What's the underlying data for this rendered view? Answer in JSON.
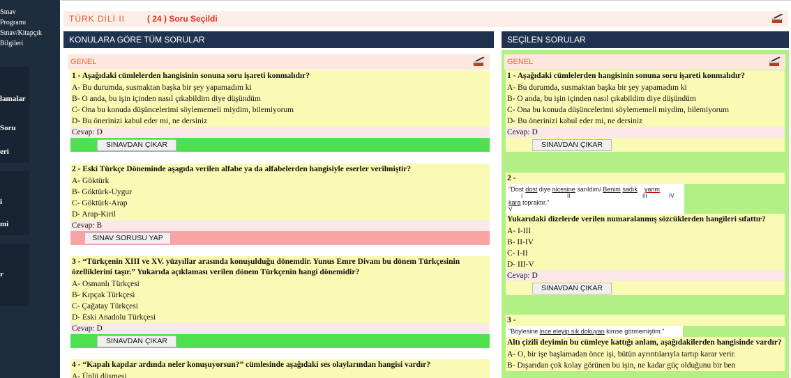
{
  "sidebar": {
    "top_links": [
      "Sınav",
      "Programı",
      "Sınav/Kitapçık",
      "Bilgileri"
    ],
    "blocks": [
      {
        "label": "lamalar"
      },
      {
        "label": "Soru"
      },
      {
        "label": "eri"
      },
      {
        "label": "i"
      },
      {
        "label": "mi"
      },
      {
        "label": "r"
      }
    ]
  },
  "header": {
    "title": "TÜRK DİLİ II",
    "selected": "( 24 ) Soru Seçildi"
  },
  "left": {
    "heading": "KONULARA GÖRE TÜM SORULAR",
    "section": "GENEL",
    "questions": [
      {
        "title": "1 - Aşağıdaki cümlelerden hangisinin sonuna soru işareti konmalıdır?",
        "options": [
          "A- Bu durumda, susmaktan başka bir şey yapamadım ki",
          "B- O anda, bu işin içinden nasıl çıkabildim diye düşündüm",
          "C- Ona bu konuda düşüncelerimi söylememeli miydim, bilemiyorum",
          "D- Bu önerinizi kabul eder mi, ne dersiniz"
        ],
        "answer": "Cevap: D",
        "button": "SINAVDAN ÇIKAR"
      },
      {
        "title": "2 - Eski Türkçe Döneminde aşagıda verilen alfabe ya da alfabelerden hangisiyle eserler verilmiştir?",
        "options": [
          "A- Göktürk",
          "B- Göktürk-Uygur",
          "C- Göktürk-Arap",
          "D- Arap-Kiril"
        ],
        "answer": "Cevap: B",
        "button": "SINAV SORUSU YAP"
      },
      {
        "title": "3 - “Türkçenin XIII ve XV. yüzyıllar arasında konuşulduğu dönemdir. Yunus Emre Divanı bu dönem Türkçesinin özelliklerini taşır.” Yukarıda açıklaması verilen dönem Türkçenin hangi dönemidir?",
        "options": [
          "A- Osmanlı Türkçesi",
          "B- Kıpçak Türkçesi",
          "C- Çağatay Türkçesi",
          "D- Eski Anadolu Türkçesi"
        ],
        "answer": "Cevap: D",
        "button": "SINAVDAN ÇIKAR"
      },
      {
        "title": "4 - “Kapalı kapılar ardında neler konuşuyorsun?” cümlesinde aşağıdaki ses olaylarından hangisi vardır?",
        "options": [
          "A- Ünlü düşmesi"
        ]
      }
    ]
  },
  "right": {
    "heading": "SEÇİLEN SORULAR",
    "section": "GENEL",
    "q1": {
      "title": "1 - Aşağıdaki cümlelerden hangisinin sonuna soru işareti konmalıdır?",
      "options": [
        "A- Bu durumda, susmaktan başka bir şey yapamadım ki",
        "B- O anda, bu işin içinden nasıl çıkabildim diye düşündüm",
        "C- Ona bu konuda düşüncelerimi söylememeli miydim, bilemiyorum",
        "D- Bu önerinizi kabul eder mi, ne dersiniz"
      ],
      "answer": "Cevap: D",
      "button": "SINAVDAN ÇIKAR"
    },
    "q2": {
      "number": "2 -",
      "quote_a": "\"Dost ",
      "quote_dost": "dost",
      "quote_b": " diye ",
      "quote_nicesine": "nicesine",
      "quote_c": " sarıldım/ ",
      "quote_benim": "Benim",
      "quote_sadik": "sadık",
      "quote_yarim": "yarim",
      "quote_kara": "kara",
      "quote_d": " topraktır.\"",
      "numerals": [
        "I",
        "II",
        "III",
        "IV",
        "V"
      ],
      "title": "Yukarıdaki dizelerde verilen numaralanmış sözcüklerden hangileri sıfattır?",
      "options": [
        "A- I-III",
        "B- II-IV",
        "C- I-II",
        "D- III-V"
      ],
      "answer": "Cevap: D",
      "button": "SINAVDAN ÇIKAR"
    },
    "q3": {
      "number": "3 -",
      "quote_a": "\"Böylesine ",
      "quote_u": "ince eleyip sık dokuyan",
      "quote_b": " kimse görmemiştim.\"",
      "title": "Altı çizili deyimin bu cümleye kattığı anlam, aşağıdakilerden hangisinde vardır?",
      "options": [
        "A- O, bir işe başlamadan önce işi, bütün ayrıntılarıyla tartıp karar verir.",
        "B- Dışarıdan çok kolay görünen bu işin, ne kadar güç olduğunu bir ben"
      ]
    }
  }
}
